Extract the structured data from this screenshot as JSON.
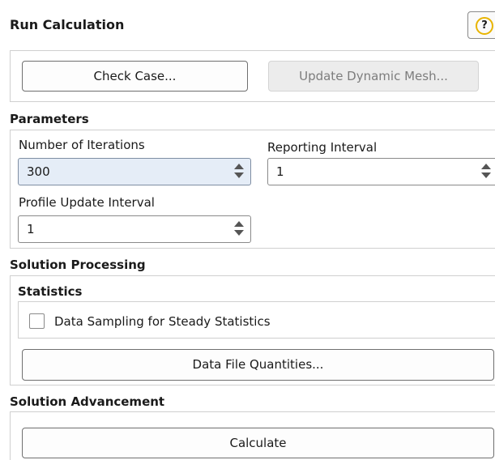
{
  "panel": {
    "title": "Run Calculation",
    "help_icon": "question-mark-icon",
    "help_glyph": "?"
  },
  "top_buttons": {
    "check_case": "Check Case...",
    "update_dynamic_mesh": "Update Dynamic Mesh..."
  },
  "parameters": {
    "title": "Parameters",
    "iterations_label": "Number of Iterations",
    "iterations_value": "300",
    "reporting_label": "Reporting Interval",
    "reporting_value": "1",
    "profile_label": "Profile Update Interval",
    "profile_value": "1"
  },
  "solution_processing": {
    "title": "Solution Processing",
    "statistics_title": "Statistics",
    "data_sampling_label": "Data Sampling for Steady Statistics",
    "data_sampling_checked": false,
    "data_file_quantities": "Data File Quantities..."
  },
  "solution_advancement": {
    "title": "Solution Advancement",
    "calculate": "Calculate"
  },
  "colors": {
    "help_ring": "#e8b400",
    "active_field_bg": "#e5edf7",
    "disabled_button_bg": "#ececec"
  }
}
